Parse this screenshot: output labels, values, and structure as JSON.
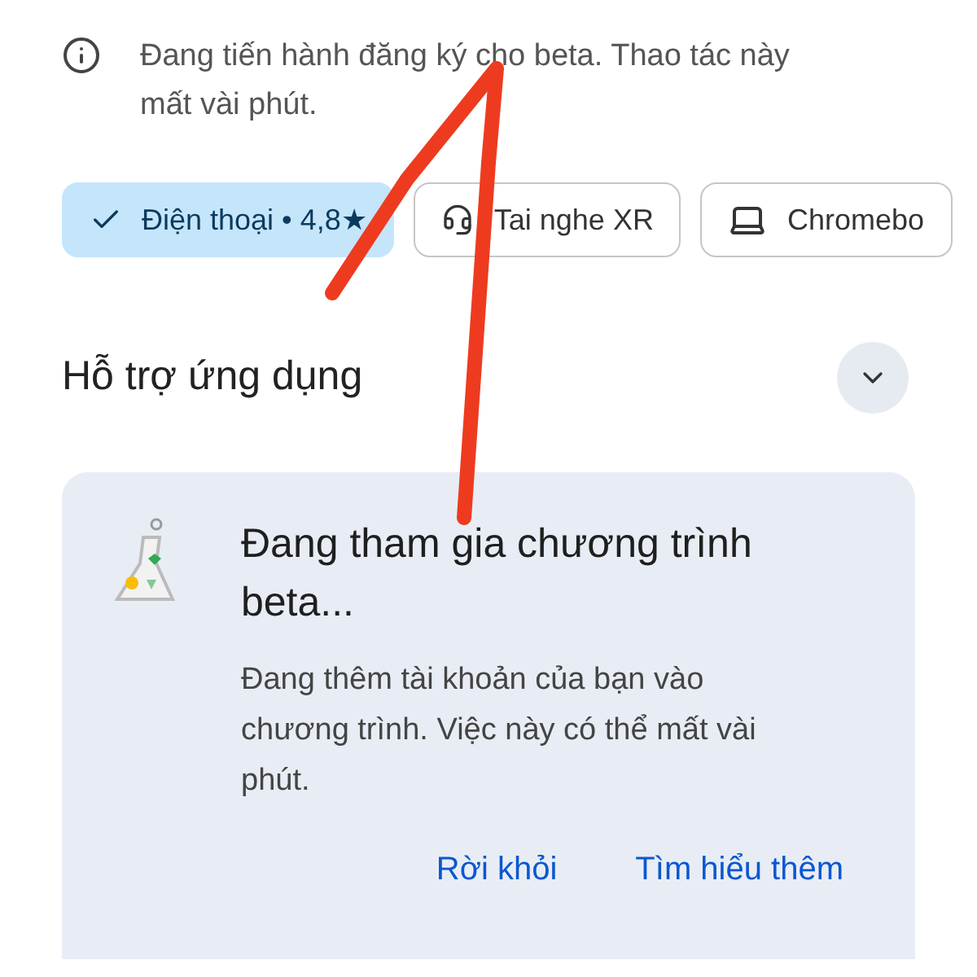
{
  "notice": {
    "text": "Đang tiến hành đăng ký cho beta. Thao tác này mất vài phút."
  },
  "chips": [
    {
      "label": "Điện thoại • 4,8★",
      "kind": "phone",
      "selected": true
    },
    {
      "label": "Tai nghe XR",
      "kind": "headset",
      "selected": false
    },
    {
      "label": "Chromebo",
      "kind": "laptop",
      "selected": false
    }
  ],
  "section": {
    "title": "Hỗ trợ ứng dụng",
    "expanded": false
  },
  "card": {
    "title": "Đang tham gia chương trình beta...",
    "body": "Đang thêm tài khoản của bạn vào chương trình. Việc này có thể mất vài phút.",
    "buttons": [
      "Rời khỏi",
      "Tìm hiểu thêm"
    ]
  }
}
